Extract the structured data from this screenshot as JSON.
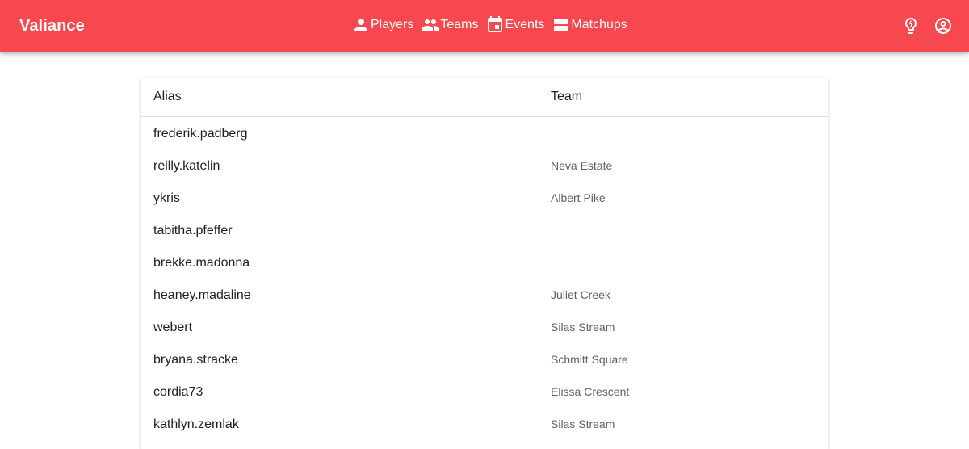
{
  "app": {
    "brand": "Valiance",
    "nav": [
      {
        "label": "Players",
        "icon": "person-icon"
      },
      {
        "label": "Teams",
        "icon": "group-icon"
      },
      {
        "label": "Events",
        "icon": "calendar-icon"
      },
      {
        "label": "Matchups",
        "icon": "matchups-icon"
      }
    ],
    "actions": [
      {
        "icon": "lightbulb-icon"
      },
      {
        "icon": "account-circle-icon"
      }
    ],
    "colors": {
      "primary": "#f7474f",
      "text": "#212121",
      "secondary_text": "#616161"
    }
  },
  "table": {
    "headers": {
      "alias": "Alias",
      "team": "Team"
    },
    "rows": [
      {
        "alias": "frederik.padberg",
        "team": ""
      },
      {
        "alias": "reilly.katelin",
        "team": "Neva Estate"
      },
      {
        "alias": "ykris",
        "team": "Albert Pike"
      },
      {
        "alias": "tabitha.pfeffer",
        "team": ""
      },
      {
        "alias": "brekke.madonna",
        "team": ""
      },
      {
        "alias": "heaney.madaline",
        "team": "Juliet Creek"
      },
      {
        "alias": "webert",
        "team": "Silas Stream"
      },
      {
        "alias": "bryana.stracke",
        "team": "Schmitt Square"
      },
      {
        "alias": "cordia73",
        "team": "Elissa Crescent"
      },
      {
        "alias": "kathlyn.zemlak",
        "team": "Silas Stream"
      }
    ]
  }
}
